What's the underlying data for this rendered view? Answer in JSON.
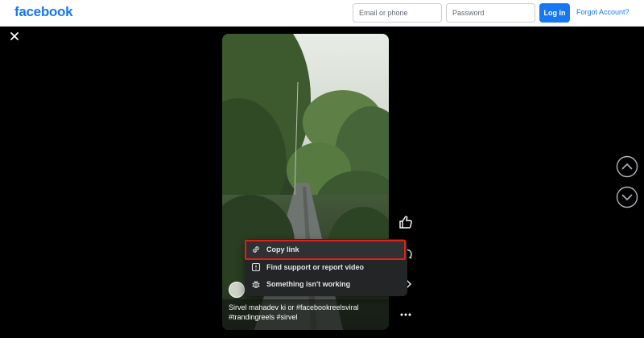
{
  "header": {
    "logo": "facebook",
    "email_placeholder": "Email or phone",
    "password_placeholder": "Password",
    "login_label": "Log In",
    "forgot_label": "Forgot Account?"
  },
  "reel": {
    "caption_line1": "Sirvel mahadev ki or #facebookreelsviral",
    "caption_line2": "#trandingreels #sirvel"
  },
  "menu": {
    "items": [
      {
        "label": "Copy link",
        "icon": "link-icon"
      },
      {
        "label": "Find support or report video",
        "icon": "report-icon"
      },
      {
        "label": "Something isn't working",
        "icon": "bug-icon"
      }
    ]
  },
  "icons": {
    "close": "close-icon",
    "like": "thumbs-up-icon",
    "more": "more-icon",
    "prev": "chevron-up-icon",
    "next": "chevron-down-icon"
  },
  "colors": {
    "brand": "#1877f2",
    "highlight": "#e0211b",
    "menu_bg": "#242526"
  }
}
